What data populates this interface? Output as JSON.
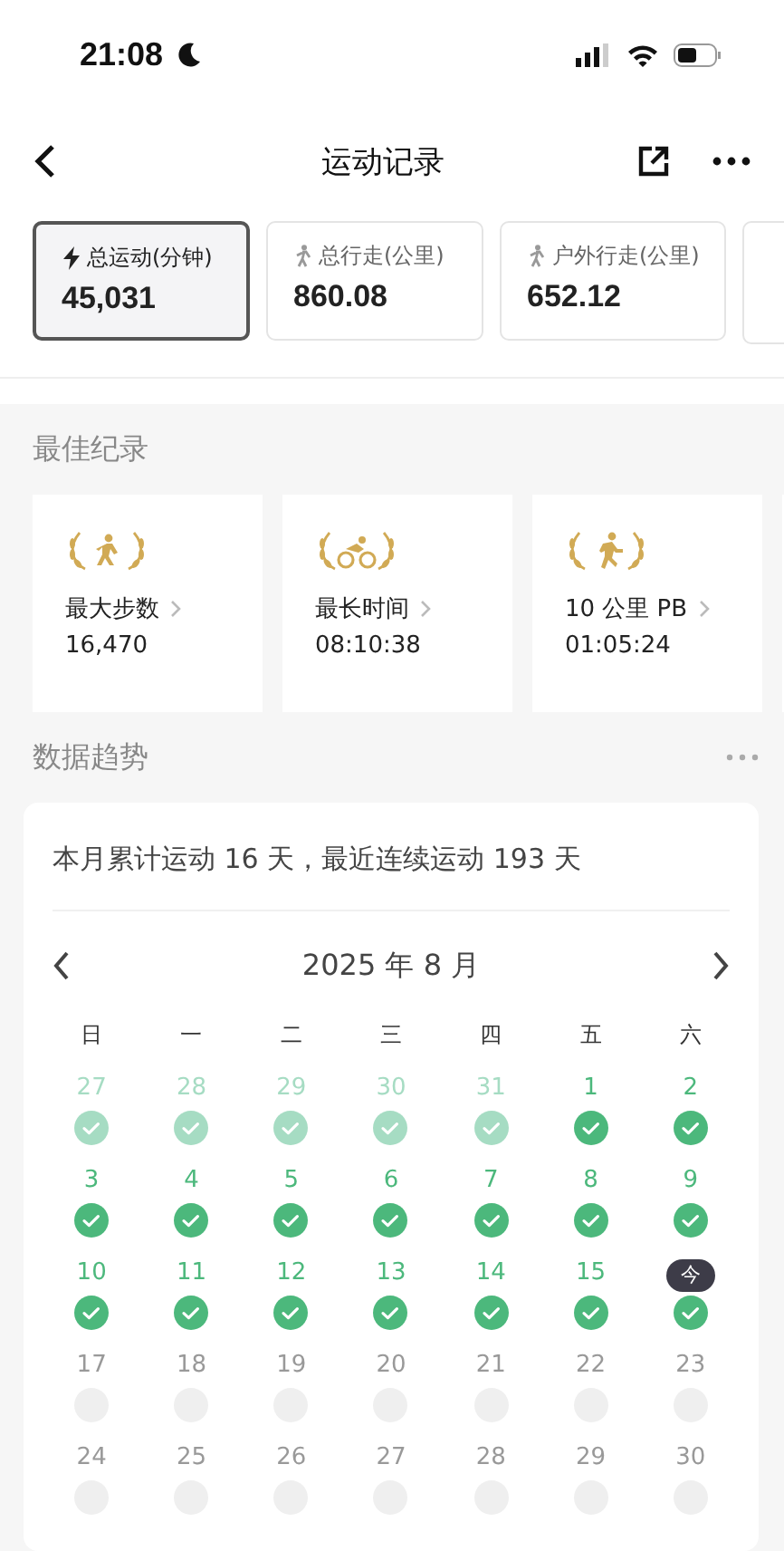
{
  "status_bar": {
    "time": "21:08"
  },
  "nav": {
    "title": "运动记录"
  },
  "stats": [
    {
      "label": "总运动(分钟)",
      "value": "45,031",
      "kind": "bolt",
      "selected": true
    },
    {
      "label": "总行走(公里)",
      "value": "860.08",
      "kind": "walk",
      "selected": false
    },
    {
      "label": "户外行走(公里)",
      "value": "652.12",
      "kind": "walk",
      "selected": false
    }
  ],
  "best_records": {
    "title": "最佳纪录",
    "items": [
      {
        "label": "最大步数",
        "value": "16,470",
        "kind": "walk"
      },
      {
        "label": "最长时间",
        "value": "08:10:38",
        "kind": "bike"
      },
      {
        "label": "10 公里 PB",
        "value": "01:05:24",
        "kind": "run"
      }
    ]
  },
  "trends": {
    "title": "数据趋势",
    "summary": "本月累计运动 16 天，最近连续运动 193 天",
    "month": "2025 年 8 月",
    "weekdays": [
      "日",
      "一",
      "二",
      "三",
      "四",
      "五",
      "六"
    ],
    "today_badge": "今",
    "days": [
      {
        "day": "27",
        "outside": true,
        "done": true,
        "today": false
      },
      {
        "day": "28",
        "outside": true,
        "done": true,
        "today": false
      },
      {
        "day": "29",
        "outside": true,
        "done": true,
        "today": false
      },
      {
        "day": "30",
        "outside": true,
        "done": true,
        "today": false
      },
      {
        "day": "31",
        "outside": true,
        "done": true,
        "today": false
      },
      {
        "day": "1",
        "outside": false,
        "done": true,
        "today": false
      },
      {
        "day": "2",
        "outside": false,
        "done": true,
        "today": false
      },
      {
        "day": "3",
        "outside": false,
        "done": true,
        "today": false
      },
      {
        "day": "4",
        "outside": false,
        "done": true,
        "today": false
      },
      {
        "day": "5",
        "outside": false,
        "done": true,
        "today": false
      },
      {
        "day": "6",
        "outside": false,
        "done": true,
        "today": false
      },
      {
        "day": "7",
        "outside": false,
        "done": true,
        "today": false
      },
      {
        "day": "8",
        "outside": false,
        "done": true,
        "today": false
      },
      {
        "day": "9",
        "outside": false,
        "done": true,
        "today": false
      },
      {
        "day": "10",
        "outside": false,
        "done": true,
        "today": false
      },
      {
        "day": "11",
        "outside": false,
        "done": true,
        "today": false
      },
      {
        "day": "12",
        "outside": false,
        "done": true,
        "today": false
      },
      {
        "day": "13",
        "outside": false,
        "done": true,
        "today": false
      },
      {
        "day": "14",
        "outside": false,
        "done": true,
        "today": false
      },
      {
        "day": "15",
        "outside": false,
        "done": true,
        "today": false
      },
      {
        "outside": false,
        "done": true,
        "today": true
      },
      {
        "day": "17",
        "outside": false,
        "done": false,
        "today": false
      },
      {
        "day": "18",
        "outside": false,
        "done": false,
        "today": false
      },
      {
        "day": "19",
        "outside": false,
        "done": false,
        "today": false
      },
      {
        "day": "20",
        "outside": false,
        "done": false,
        "today": false
      },
      {
        "day": "21",
        "outside": false,
        "done": false,
        "today": false
      },
      {
        "day": "22",
        "outside": false,
        "done": false,
        "today": false
      },
      {
        "day": "23",
        "outside": false,
        "done": false,
        "today": false
      },
      {
        "day": "24",
        "outside": false,
        "done": false,
        "today": false
      },
      {
        "day": "25",
        "outside": false,
        "done": false,
        "today": false
      },
      {
        "day": "26",
        "outside": false,
        "done": false,
        "today": false
      },
      {
        "day": "27",
        "outside": false,
        "done": false,
        "today": false
      },
      {
        "day": "28",
        "outside": false,
        "done": false,
        "today": false
      },
      {
        "day": "29",
        "outside": false,
        "done": false,
        "today": false
      },
      {
        "day": "30",
        "outside": false,
        "done": false,
        "today": false
      }
    ]
  }
}
